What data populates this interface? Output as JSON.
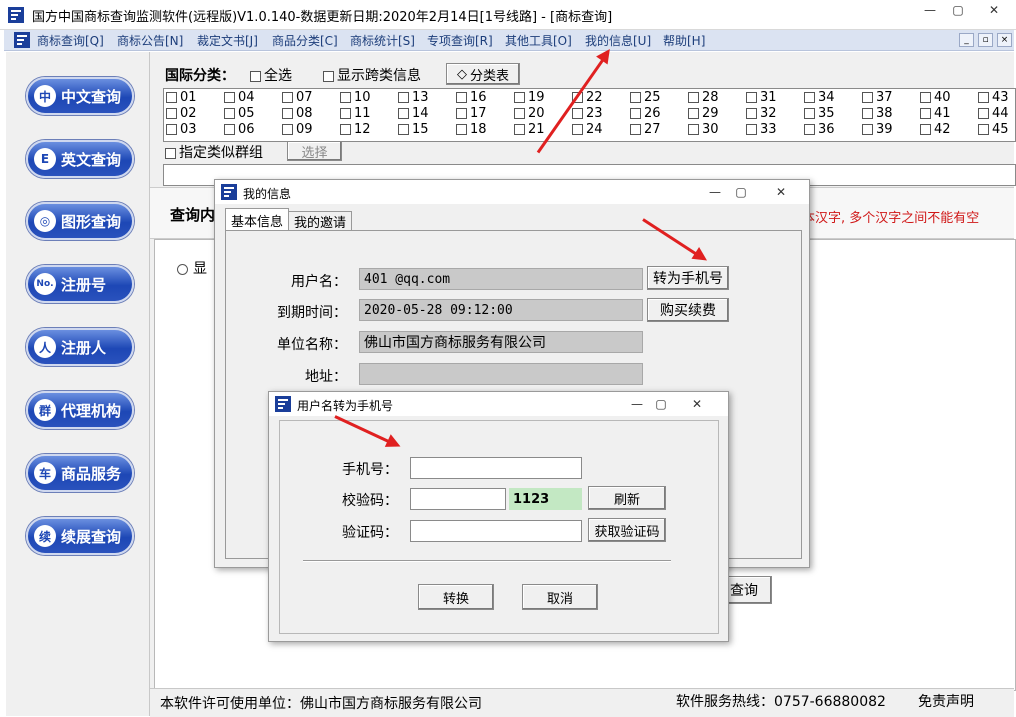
{
  "window": {
    "title": "国方中国商标查询监测软件(远程版)V1.0.140-数据更新日期:2020年2月14日[1号线路] - [商标查询]"
  },
  "menu": [
    "商标查询[Q]",
    "商标公告[N]",
    "裁定文书[J]",
    "商品分类[C]",
    "商标统计[S]",
    "专项查询[R]",
    "其他工具[O]",
    "我的信息[U]",
    "帮助[H]"
  ],
  "sidebar": [
    {
      "label": "中文查询",
      "icon": "中"
    },
    {
      "label": "英文查询",
      "icon": "E"
    },
    {
      "label": "图形查询",
      "icon": "◎"
    },
    {
      "label": "注册号",
      "icon": "No."
    },
    {
      "label": "注册人",
      "icon": "人"
    },
    {
      "label": "代理机构",
      "icon": "群"
    },
    {
      "label": "商品服务",
      "icon": "车"
    },
    {
      "label": "续展查询",
      "icon": "续"
    }
  ],
  "classification": {
    "label": "国际分类：",
    "select_all": "全选",
    "show_cross": "显示跨类信息",
    "table_button": "分类表",
    "classes": [
      "01",
      "02",
      "03",
      "04",
      "05",
      "06",
      "07",
      "08",
      "09",
      "10",
      "11",
      "12",
      "13",
      "14",
      "15",
      "16",
      "17",
      "18",
      "19",
      "20",
      "21",
      "22",
      "23",
      "24",
      "25",
      "26",
      "27",
      "28",
      "29",
      "30",
      "31",
      "32",
      "33",
      "34",
      "35",
      "36",
      "37",
      "38",
      "39",
      "40",
      "41",
      "42",
      "43",
      "44",
      "45"
    ],
    "similar_group": "指定类似群组",
    "choose_button": "选择"
  },
  "query": {
    "heading": "查询内",
    "radio_label": "显",
    "hint": "本汉字, 多个汉字之间不能有空",
    "query_button": "查询"
  },
  "statusbar": {
    "license": "本软件许可使用单位：佛山市国方商标服务有限公司",
    "hotline": "软件服务热线：0757-66880082",
    "disclaimer": "免责声明"
  },
  "my_info_dialog": {
    "title": "我的信息",
    "tabs": [
      "基本信息",
      "我的邀请"
    ],
    "username_label": "用户名：",
    "username_value": "401         @qq.com",
    "to_mobile_button": "转为手机号",
    "expiry_label": "到期时间：",
    "expiry_value": "2020-05-28 09:12:00",
    "renew_button": "购买续费",
    "company_label": "单位名称：",
    "company_value": "佛山市国方商标服务有限公司",
    "address_label": "地址：",
    "address_value": ""
  },
  "convert_dialog": {
    "title": "用户名转为手机号",
    "phone_label": "手机号：",
    "check_label": "校验码：",
    "check_code": "1123",
    "refresh_button": "刷新",
    "verify_label": "验证码：",
    "get_code_button": "获取验证码",
    "convert_button": "转换",
    "cancel_button": "取消"
  }
}
